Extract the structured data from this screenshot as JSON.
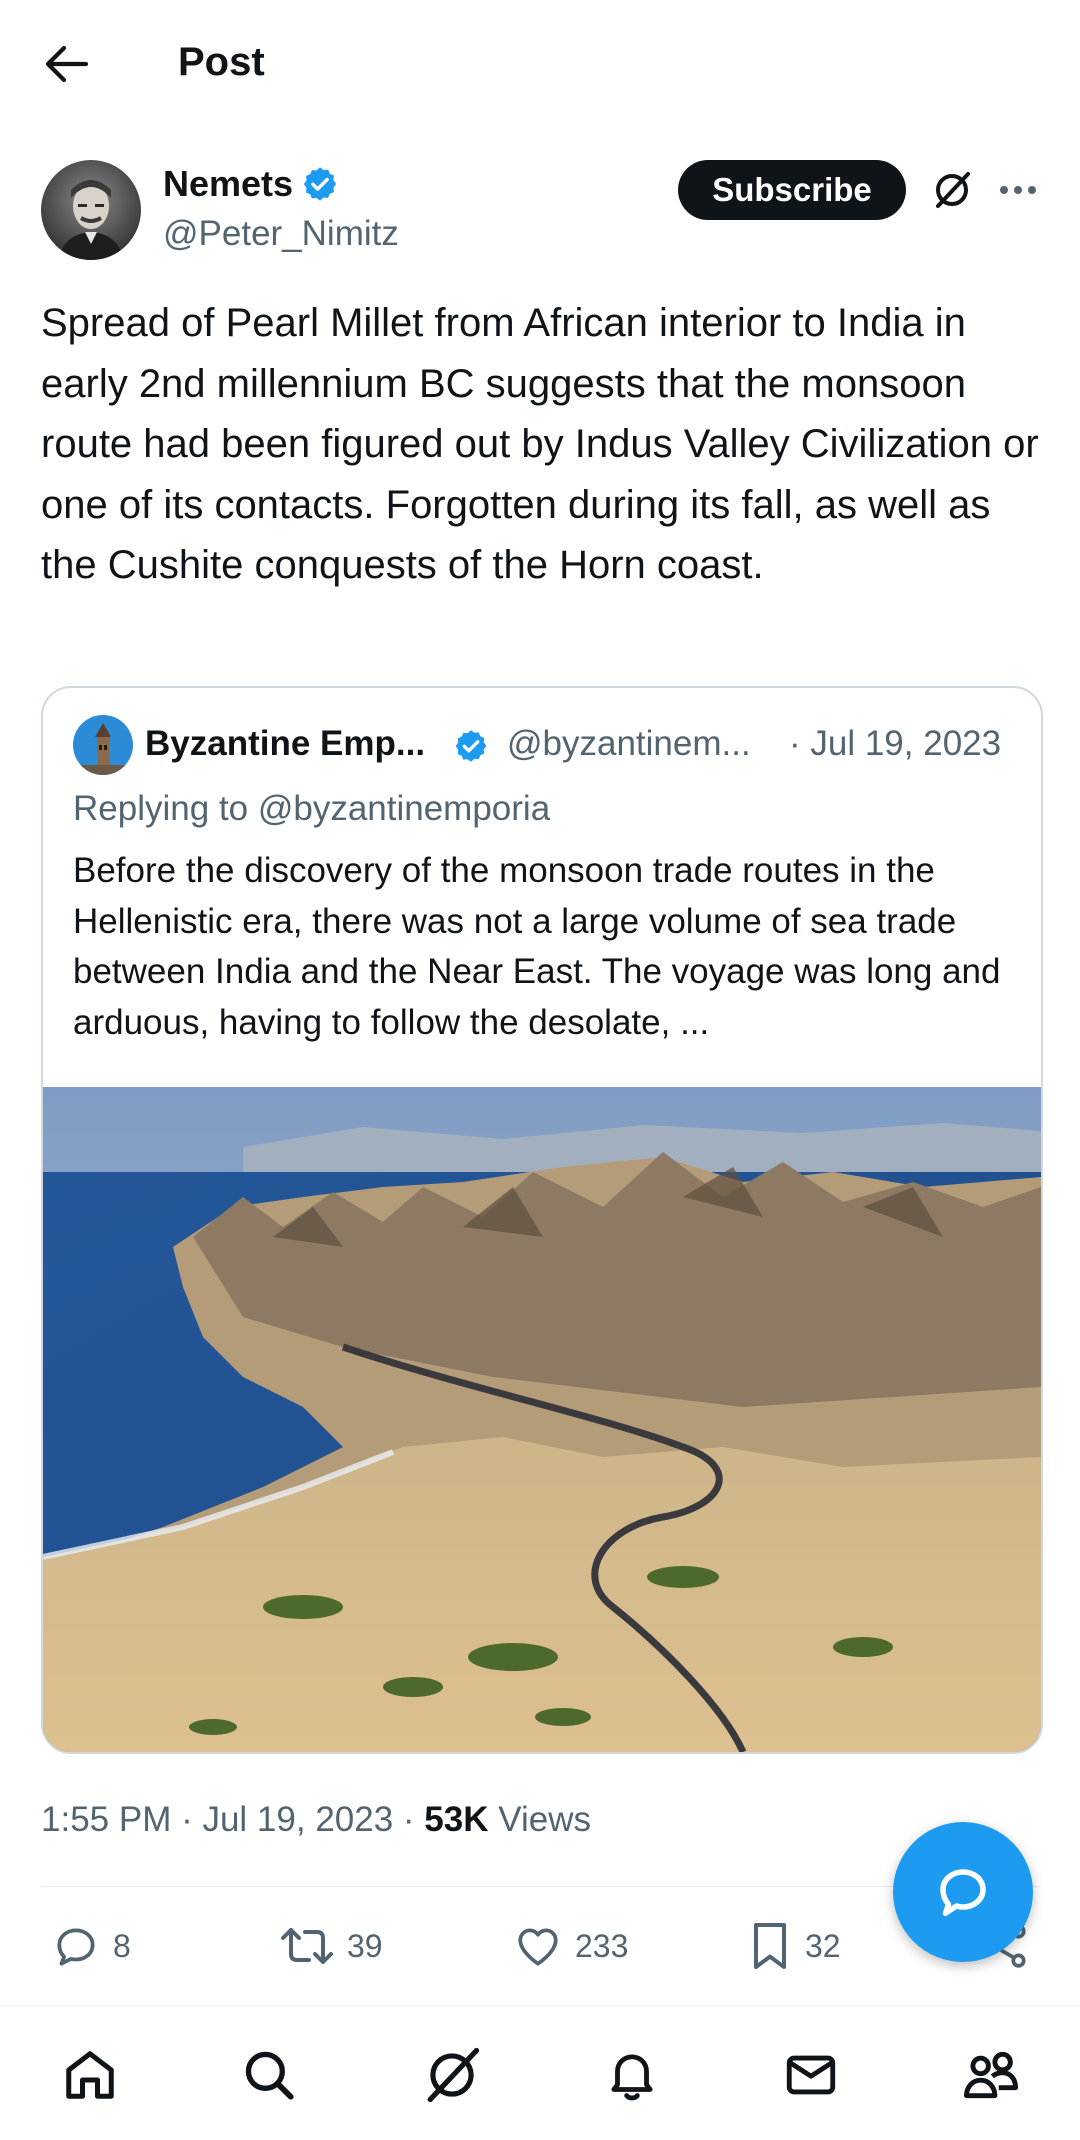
{
  "header": {
    "title": "Post"
  },
  "post": {
    "author_name": "Nemets",
    "author_handle": "@Peter_Nimitz",
    "subscribe_label": "Subscribe",
    "text": "Spread of Pearl Millet from African interior to India in early 2nd millennium BC suggests that the monsoon route had been figured out by Indus Valley Civilization or one of its contacts. Forgotten during its fall, as well as the Cushite conquests of the Horn coast.",
    "time": "1:55 PM",
    "date": "Jul 19, 2023",
    "views_count": "53K",
    "views_label": "Views"
  },
  "quote": {
    "author_name": "Byzantine Emp...",
    "author_handle": "@byzantinem...",
    "date": "· Jul 19, 2023",
    "replying_to": "Replying to @byzantinemporia",
    "text": "Before the discovery of the monsoon trade routes in the Hellenistic era, there was not a large volume of sea trade between India and the Near East. The voyage was long and arduous, having to follow the desolate, ..."
  },
  "actions": {
    "replies": "8",
    "reposts": "39",
    "likes": "233",
    "bookmarks": "32"
  },
  "colors": {
    "accent": "#1d9bf0",
    "text_primary": "#0f1419",
    "text_secondary": "#536471",
    "border": "#cfd9de"
  },
  "icons": {
    "back": "arrow-left-icon",
    "verified": "verified-badge-icon",
    "grok": "grok-icon",
    "more": "more-horizontal-icon",
    "reply": "reply-icon",
    "repost": "repost-icon",
    "like": "heart-icon",
    "bookmark": "bookmark-icon",
    "share": "share-icon",
    "compose": "compose-reply-icon",
    "nav_home": "home-icon",
    "nav_search": "search-icon",
    "nav_grok": "grok-icon",
    "nav_notifications": "bell-icon",
    "nav_messages": "mail-icon",
    "nav_communities": "communities-icon"
  }
}
